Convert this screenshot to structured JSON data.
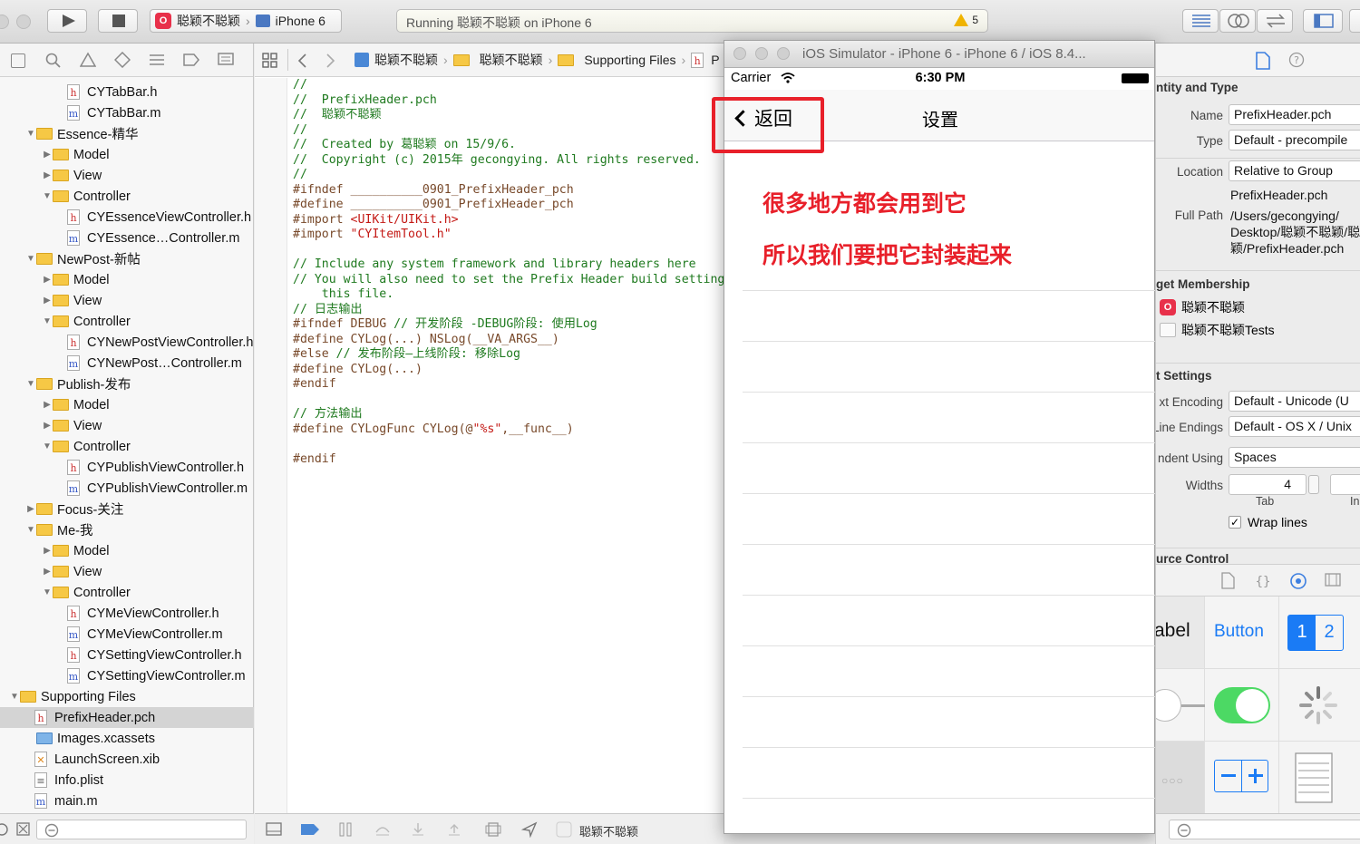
{
  "toolbar": {
    "scheme": "聪颖不聪颖",
    "device": "iPhone 6",
    "status_text": "Running 聪颖不聪颖 on iPhone 6",
    "warning_count": "5"
  },
  "navigator": {
    "items": [
      {
        "label": "CYTabBar.h",
        "type": "h",
        "indent": 3
      },
      {
        "label": "CYTabBar.m",
        "type": "m",
        "indent": 3
      },
      {
        "label": "Essence-精华",
        "type": "folder",
        "indent": 1,
        "open": true
      },
      {
        "label": "Model",
        "type": "folder",
        "indent": 2,
        "open": false
      },
      {
        "label": "View",
        "type": "folder",
        "indent": 2,
        "open": false
      },
      {
        "label": "Controller",
        "type": "folder",
        "indent": 2,
        "open": true
      },
      {
        "label": "CYEssenceViewController.h",
        "type": "h",
        "indent": 3
      },
      {
        "label": "CYEssence…Controller.m",
        "type": "m",
        "indent": 3
      },
      {
        "label": "NewPost-新帖",
        "type": "folder",
        "indent": 1,
        "open": true
      },
      {
        "label": "Model",
        "type": "folder",
        "indent": 2,
        "open": false
      },
      {
        "label": "View",
        "type": "folder",
        "indent": 2,
        "open": false
      },
      {
        "label": "Controller",
        "type": "folder",
        "indent": 2,
        "open": true
      },
      {
        "label": "CYNewPostViewController.h",
        "type": "h",
        "indent": 3
      },
      {
        "label": "CYNewPost…Controller.m",
        "type": "m",
        "indent": 3
      },
      {
        "label": "Publish-发布",
        "type": "folder",
        "indent": 1,
        "open": true
      },
      {
        "label": "Model",
        "type": "folder",
        "indent": 2,
        "open": false
      },
      {
        "label": "View",
        "type": "folder",
        "indent": 2,
        "open": false
      },
      {
        "label": "Controller",
        "type": "folder",
        "indent": 2,
        "open": true
      },
      {
        "label": "CYPublishViewController.h",
        "type": "h",
        "indent": 3
      },
      {
        "label": "CYPublishViewController.m",
        "type": "m",
        "indent": 3
      },
      {
        "label": "Focus-关注",
        "type": "folder",
        "indent": 1,
        "open": false
      },
      {
        "label": "Me-我",
        "type": "folder",
        "indent": 1,
        "open": true
      },
      {
        "label": "Model",
        "type": "folder",
        "indent": 2,
        "open": false
      },
      {
        "label": "View",
        "type": "folder",
        "indent": 2,
        "open": false
      },
      {
        "label": "Controller",
        "type": "folder",
        "indent": 2,
        "open": true
      },
      {
        "label": "CYMeViewController.h",
        "type": "h",
        "indent": 3
      },
      {
        "label": "CYMeViewController.m",
        "type": "m",
        "indent": 3
      },
      {
        "label": "CYSettingViewController.h",
        "type": "h",
        "indent": 3
      },
      {
        "label": "CYSettingViewController.m",
        "type": "m",
        "indent": 3
      },
      {
        "label": "Supporting Files",
        "type": "folder",
        "indent": 0,
        "open": true
      },
      {
        "label": "PrefixHeader.pch",
        "type": "h",
        "indent": 1,
        "selected": true
      },
      {
        "label": "Images.xcassets",
        "type": "folderblue",
        "indent": 1
      },
      {
        "label": "LaunchScreen.xib",
        "type": "xib",
        "indent": 1
      },
      {
        "label": "Info.plist",
        "type": "plist",
        "indent": 1
      },
      {
        "label": "main.m",
        "type": "m",
        "indent": 1
      }
    ]
  },
  "editor": {
    "breadcrumbs": [
      "聪颖不聪颖",
      "聪颖不聪颖",
      "Supporting Files",
      "P"
    ],
    "code_lines": [
      [
        [
          "c",
          "//"
        ]
      ],
      [
        [
          "c",
          "//  PrefixHeader.pch"
        ]
      ],
      [
        [
          "c",
          "//  聪颖不聪颖"
        ]
      ],
      [
        [
          "c",
          "//"
        ]
      ],
      [
        [
          "c",
          "//  Created by 葛聪颖 on 15/9/6."
        ]
      ],
      [
        [
          "c",
          "//  Copyright (c) 2015年 gecongying. All rights reserved."
        ]
      ],
      [
        [
          "c",
          "//"
        ]
      ],
      [
        [
          "p",
          "#ifndef __________0901_PrefixHeader_pch"
        ]
      ],
      [
        [
          "p",
          "#define __________0901_PrefixHeader_pch"
        ]
      ],
      [
        [
          "p",
          "#import "
        ],
        [
          "s",
          "<UIKit/UIKit.h>"
        ]
      ],
      [
        [
          "p",
          "#import "
        ],
        [
          "s",
          "\"CYItemTool.h\""
        ]
      ],
      [
        [
          "t",
          ""
        ]
      ],
      [
        [
          "c",
          "// Include any system framework and library headers here"
        ]
      ],
      [
        [
          "c",
          "// You will also need to set the Prefix Header build setting"
        ]
      ],
      [
        [
          "c",
          "    this file."
        ]
      ],
      [
        [
          "c",
          "// 日志输出"
        ]
      ],
      [
        [
          "p",
          "#ifndef DEBUG "
        ],
        [
          "c",
          "// 开发阶段 -DEBUG阶段: 使用Log"
        ]
      ],
      [
        [
          "p",
          "#define CYLog(...) NSLog(__VA_ARGS__)"
        ]
      ],
      [
        [
          "p",
          "#else "
        ],
        [
          "c",
          "// 发布阶段—上线阶段: 移除Log"
        ]
      ],
      [
        [
          "p",
          "#define CYLog(...)"
        ]
      ],
      [
        [
          "p",
          "#endif"
        ]
      ],
      [
        [
          "t",
          ""
        ]
      ],
      [
        [
          "c",
          "// 方法输出"
        ]
      ],
      [
        [
          "p",
          "#define CYLogFunc CYLog(@"
        ],
        [
          "s",
          "\"%s\""
        ],
        [
          "p",
          ",__func__)"
        ]
      ],
      [
        [
          "t",
          ""
        ]
      ],
      [
        [
          "p",
          "#endif"
        ]
      ]
    ],
    "bottom_target": "聪颖不聪颖"
  },
  "simulator": {
    "title": "iOS Simulator - iPhone 6 - iPhone 6 / iOS 8.4...",
    "carrier": "Carrier",
    "time": "6:30 PM",
    "back_label": "返回",
    "nav_title": "设置",
    "annotation_1": "很多地方都会用到它",
    "annotation_2": "所以我们要把它封装起来",
    "accent_color": "#e8202a"
  },
  "inspector": {
    "identity_title": "ntity and Type",
    "name_label": "Name",
    "name_value": "PrefixHeader.pch",
    "type_label": "Type",
    "type_value": "Default - precompile",
    "location_label": "Location",
    "location_value": "Relative to Group",
    "location_file": "PrefixHeader.pch",
    "fullpath_label": "Full Path",
    "fullpath_line1": "/Users/gecongying/",
    "fullpath_line2": "Desktop/聪颖不聪颖/聪",
    "fullpath_line3": "颖/PrefixHeader.pch",
    "membership_title": "get Membership",
    "target1": "聪颖不聪颖",
    "target2": "聪颖不聪颖Tests",
    "text_settings_title": "t Settings",
    "encoding_label": "xt Encoding",
    "encoding_value": "Default - Unicode (U",
    "line_endings_label": "Line Endings",
    "line_endings_value": "Default - OS X / Unix",
    "indent_label": "ndent Using",
    "indent_value": "Spaces",
    "widths_label": "Widths",
    "tab_width": "4",
    "tab_label": "Tab",
    "indent_short": "In",
    "wrap_label": "Wrap lines",
    "source_control_title": "urce Control",
    "lib_label": "abel",
    "lib_button": "Button",
    "seg_1": "1",
    "seg_2": "2"
  }
}
